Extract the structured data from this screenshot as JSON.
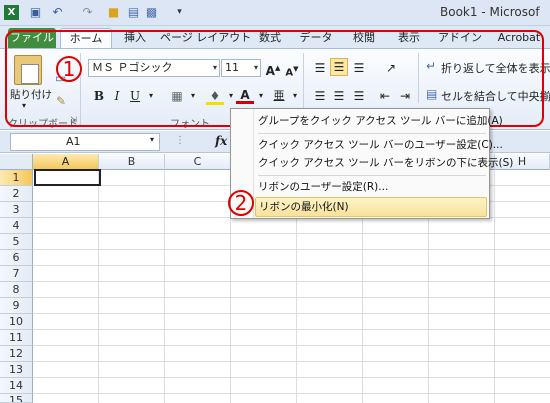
{
  "window": {
    "title": "Book1 - Microsof"
  },
  "quick_access": {
    "icons": [
      "excel-logo-icon",
      "save-icon",
      "undo-icon",
      "redo-icon",
      "open-folder-icon",
      "print-preview-icon",
      "customize-icon"
    ]
  },
  "tabs": [
    "ファイル",
    "ホーム",
    "挿入",
    "ページ レイアウト",
    "数式",
    "データ",
    "校閲",
    "表示",
    "アドイン",
    "Acrobat"
  ],
  "ribbon": {
    "paste_label": "貼り付け",
    "clipboard_label": "クリップボード",
    "font_name": "ＭＳ Ｐゴシック",
    "font_size": "11",
    "bold": "B",
    "italic": "I",
    "underline": "U",
    "font_color_letter": "A",
    "font_group_label": "フォント",
    "wrap_text": "折り返して全体を表示する",
    "merge_center": "セルを結合して中央揃え",
    "grow_font": "A",
    "shrink_font": "A"
  },
  "formula_bar": {
    "name_box": "A1",
    "fx": "fx"
  },
  "grid": {
    "columns": [
      "A",
      "B",
      "C",
      "D",
      "E",
      "F",
      "G",
      "H"
    ],
    "rows": [
      "1",
      "2",
      "3",
      "4",
      "5",
      "6",
      "7",
      "8",
      "9",
      "10",
      "11",
      "12",
      "13",
      "14",
      "15"
    ]
  },
  "context_menu": {
    "items": [
      "グループをクイック アクセス ツール バーに追加(A)",
      "クイック アクセス ツール バーのユーザー設定(C)...",
      "クイック アクセス ツール バーをリボンの下に表示(S)",
      "リボンのユーザー設定(R)...",
      "リボンの最小化(N)"
    ]
  },
  "annotations": {
    "one": "1",
    "two": "2"
  },
  "colors": {
    "highlight_red": "#e00000",
    "file_tab_green": "#3f8d3f",
    "menu_highlight": "#f9e29a"
  }
}
